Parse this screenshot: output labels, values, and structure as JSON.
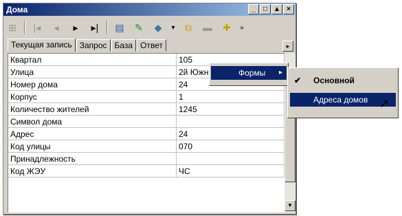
{
  "window": {
    "title": "Дома",
    "controls": {
      "minimize": "_",
      "restore": "□",
      "up": "▲",
      "close": "×"
    }
  },
  "toolbar": {
    "icons": [
      "grid-icon",
      "first-record-icon",
      "prev-record-icon",
      "next-record-icon",
      "last-record-icon",
      "form-icon",
      "edit-icon",
      "palette-icon",
      "copy-icon",
      "folder-icon",
      "new-folder-icon"
    ],
    "glyphs": {
      "grid": "⊞",
      "first": "|◂",
      "prev": "◂",
      "next": "▸",
      "last": "▸|",
      "form": "▤",
      "edit": "✎",
      "palette": "◆",
      "dropdown": "▾",
      "copy": "⧉",
      "folder": "▬",
      "new": "✚",
      "overflow": "»"
    }
  },
  "tabs": [
    "Текущая запись",
    "Запрос",
    "База",
    "Ответ"
  ],
  "tab_arrow": "▸",
  "rows": [
    {
      "name": "Квартал",
      "value": "105"
    },
    {
      "name": "Улица",
      "value": "2й Южный пер."
    },
    {
      "name": "Номер дома",
      "value": "24"
    },
    {
      "name": "Корпус",
      "value": "1"
    },
    {
      "name": "Количество жителей",
      "value": "1245"
    },
    {
      "name": "Символ дома",
      "value": ""
    },
    {
      "name": "Адрес",
      "value": "24"
    },
    {
      "name": "Код улицы",
      "value": "070"
    },
    {
      "name": "Принадлежность",
      "value": ""
    },
    {
      "name": "Код ЖЭУ",
      "value": "ЧС"
    }
  ],
  "scroll_down": "▼",
  "context_menu": {
    "label": "Формы",
    "arrow": "▸"
  },
  "submenu": {
    "items": [
      {
        "label": "Основной",
        "checked": true,
        "check": "✔"
      },
      {
        "label": "Адреса домов",
        "checked": false,
        "check": ""
      }
    ]
  },
  "cursor": "➚"
}
